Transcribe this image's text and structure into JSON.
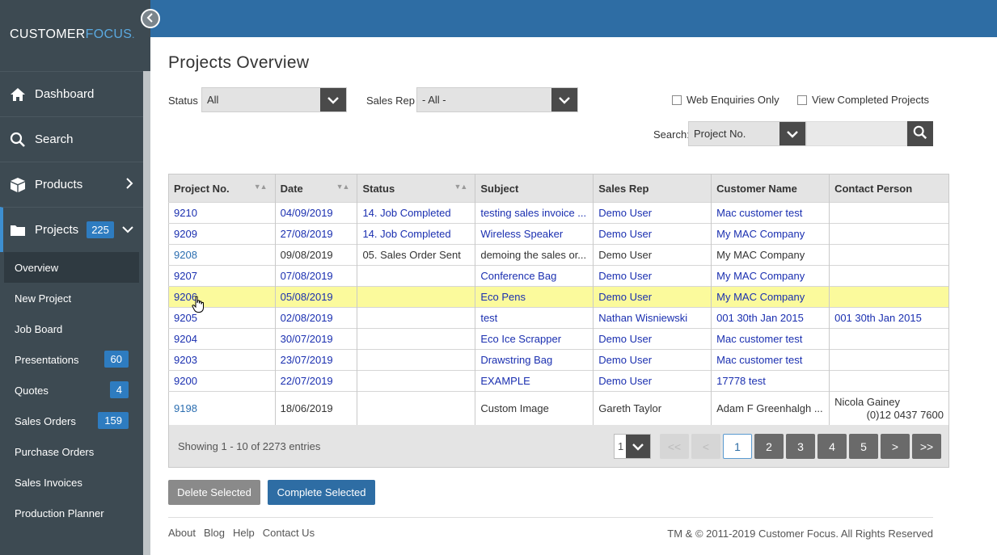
{
  "brand": {
    "part1": "CUSTOMER",
    "part2": "FOCUS",
    "dot": "."
  },
  "sidebar": {
    "main_items": [
      {
        "label": "Dashboard",
        "icon": "home-icon"
      },
      {
        "label": "Search",
        "icon": "search-icon"
      },
      {
        "label": "Products",
        "icon": "box-icon"
      },
      {
        "label": "Projects",
        "icon": "folder-icon",
        "badge": "225"
      }
    ],
    "sub_items": [
      {
        "label": "Overview"
      },
      {
        "label": "New Project"
      },
      {
        "label": "Job Board"
      },
      {
        "label": "Presentations",
        "badge": "60"
      },
      {
        "label": "Quotes",
        "badge": "4"
      },
      {
        "label": "Sales Orders",
        "badge": "159"
      },
      {
        "label": "Purchase Orders"
      },
      {
        "label": "Sales Invoices"
      },
      {
        "label": "Production Planner"
      }
    ]
  },
  "page": {
    "title": "Projects Overview"
  },
  "filters": {
    "status_label": "Status",
    "status_value": "All",
    "salesrep_label": "Sales Rep",
    "salesrep_value": "- All -",
    "web_enquiries_label": "Web Enquiries Only",
    "view_completed_label": "View Completed Projects",
    "search_label": "Search:",
    "search_field_value": "Project No."
  },
  "table": {
    "headers": [
      "Project No.",
      "Date",
      "Status",
      "Subject",
      "Sales Rep",
      "Customer Name",
      "Contact Person"
    ],
    "rows": [
      {
        "project": "9210",
        "date": "04/09/2019",
        "status": "14. Job Completed",
        "subject": "testing sales invoice ...",
        "rep": "Demo User",
        "customer": "Mac customer test",
        "contact": ""
      },
      {
        "project": "9209",
        "date": "27/08/2019",
        "status": "14. Job Completed",
        "subject": "Wireless Speaker",
        "rep": "Demo User",
        "customer": "My MAC Company",
        "contact": ""
      },
      {
        "project": "9208",
        "date": "09/08/2019",
        "status": "05. Sales Order Sent",
        "subject": "demoing the sales or...",
        "rep": "Demo User",
        "customer": "My MAC Company",
        "contact": ""
      },
      {
        "project": "9207",
        "date": "07/08/2019",
        "status": "",
        "subject": "Conference Bag",
        "rep": "Demo User",
        "customer": "My MAC Company",
        "contact": ""
      },
      {
        "project": "9206",
        "date": "05/08/2019",
        "status": "",
        "subject": "Eco Pens",
        "rep": "Demo User",
        "customer": "My MAC Company",
        "contact": ""
      },
      {
        "project": "9205",
        "date": "02/08/2019",
        "status": "",
        "subject": "test",
        "rep": "Nathan Wisniewski",
        "customer": "001 30th Jan 2015",
        "contact": "001 30th Jan 2015"
      },
      {
        "project": "9204",
        "date": "30/07/2019",
        "status": "",
        "subject": "Eco Ice Scrapper",
        "rep": "Demo User",
        "customer": "Mac customer test",
        "contact": ""
      },
      {
        "project": "9203",
        "date": "23/07/2019",
        "status": "",
        "subject": "Drawstring Bag",
        "rep": "Demo User",
        "customer": "Mac customer test",
        "contact": ""
      },
      {
        "project": "9200",
        "date": "22/07/2019",
        "status": "",
        "subject": "EXAMPLE",
        "rep": "Demo User",
        "customer": "17778 test",
        "contact": ""
      },
      {
        "project": "9198",
        "date": "18/06/2019",
        "status": "",
        "subject": "Custom Image",
        "rep": "Gareth Taylor",
        "customer": "Adam F Greenhalgh ...",
        "contact": "Nicola Gainey",
        "contact_phone": "(0)12 0437 7600"
      }
    ]
  },
  "pagination": {
    "showing": "Showing 1 - 10 of 2273 entries",
    "page_size": "1",
    "first": "<<",
    "prev": "<",
    "pages": [
      "1",
      "2",
      "3",
      "4",
      "5"
    ],
    "next": ">",
    "last": ">>"
  },
  "actions": {
    "delete_label": "Delete Selected",
    "complete_label": "Complete Selected"
  },
  "footer": {
    "links": [
      "About",
      "Blog",
      "Help",
      "Contact Us"
    ],
    "copyright": "TM & © 2011-2019 Customer Focus. All Rights Reserved"
  }
}
